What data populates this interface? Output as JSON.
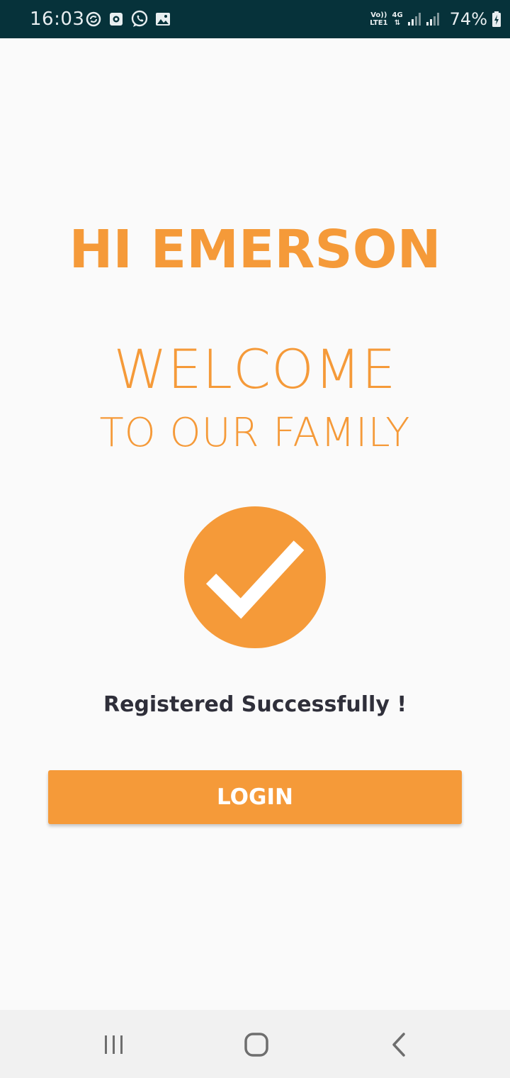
{
  "status_bar": {
    "time": "16:03",
    "network_top": "Vo))",
    "network_bottom": "LTE1",
    "network_type": "4G",
    "battery": "74%",
    "left_icons": [
      "sync-icon",
      "screen-record-icon",
      "whatsapp-icon",
      "gallery-icon"
    ],
    "right_icons": [
      "signal-icon",
      "signal-icon",
      "battery-charging-icon"
    ]
  },
  "main": {
    "greeting": "HI EMERSON",
    "welcome": "WELCOME",
    "subtitle": "TO OUR FAMILY",
    "success_icon": "checkmark-circle-icon",
    "success_message": "Registered Successfully !",
    "login_button": "LOGIN"
  },
  "nav_bar": {
    "buttons": [
      "recent-apps-icon",
      "home-icon",
      "back-icon"
    ]
  },
  "colors": {
    "accent": "#f59a39",
    "status_bar": "#06323a",
    "text_dark": "#2f2f3a",
    "background": "#fafafa"
  }
}
